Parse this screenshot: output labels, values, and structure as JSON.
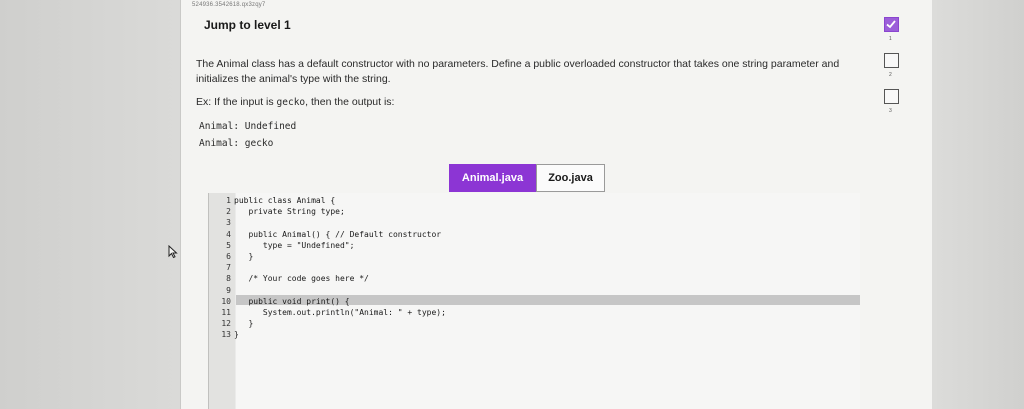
{
  "header": {
    "crumb": "524936.3542618.qx3zqy7",
    "jump_label": "Jump to level 1"
  },
  "prompt": {
    "description": "The Animal class has a default constructor with no parameters. Define a public overloaded constructor that takes one string parameter and initializes the animal's type with the string.",
    "example_prefix": "Ex: If the input is ",
    "example_input": "gecko",
    "example_suffix": ", then the output is:",
    "output_lines": [
      "Animal: Undefined",
      "Animal: gecko"
    ]
  },
  "tabs": [
    {
      "label": "Animal.java",
      "active": true
    },
    {
      "label": "Zoo.java",
      "active": false
    }
  ],
  "editor": {
    "lines": [
      {
        "n": "1",
        "text": "public class Animal {"
      },
      {
        "n": "2",
        "text": "   private String type;"
      },
      {
        "n": "3",
        "text": ""
      },
      {
        "n": "4",
        "text": "   public Animal() { // Default constructor"
      },
      {
        "n": "5",
        "text": "      type = \"Undefined\";"
      },
      {
        "n": "6",
        "text": "   }"
      },
      {
        "n": "7",
        "text": ""
      },
      {
        "n": "8",
        "text": "   /* Your code goes here */"
      },
      {
        "n": "9",
        "text": ""
      },
      {
        "n": "10",
        "text": "   public void print() {"
      },
      {
        "n": "11",
        "text": "      System.out.println(\"Animal: \" + type);"
      },
      {
        "n": "12",
        "text": "   }"
      },
      {
        "n": "13",
        "text": "}"
      }
    ],
    "highlighted_line": "9"
  },
  "levels": [
    {
      "num": "1",
      "completed": true
    },
    {
      "num": "2",
      "completed": false
    },
    {
      "num": "3",
      "completed": false
    }
  ],
  "colors": {
    "accent": "#8c35d4",
    "check_done": "#9b5ed9"
  }
}
